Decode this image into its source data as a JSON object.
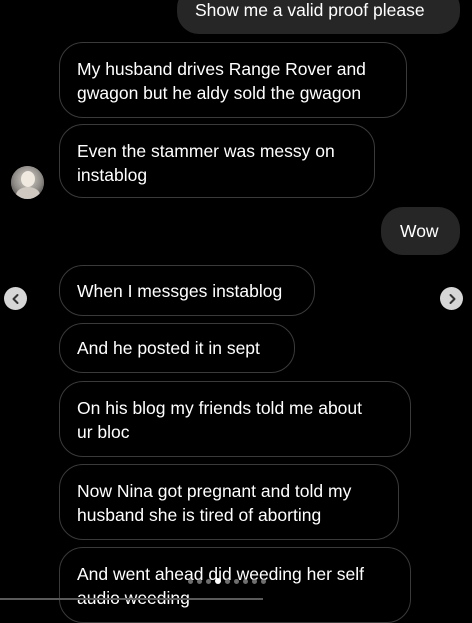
{
  "messages": [
    {
      "dir": "out",
      "lines": [
        "Show me a valid proof please"
      ]
    },
    {
      "dir": "in",
      "lines": [
        "My husband drives Range Rover and",
        "gwagon but he aldy sold the gwagon"
      ]
    },
    {
      "dir": "in",
      "lines": [
        "Even the stammer was messy on",
        "instablog"
      ]
    },
    {
      "dir": "out",
      "lines": [
        "Wow"
      ]
    },
    {
      "dir": "in",
      "lines": [
        "When I messges instablog"
      ]
    },
    {
      "dir": "in",
      "lines": [
        "And he posted it in sept"
      ]
    },
    {
      "dir": "in",
      "lines": [
        "On his blog my friends told me about",
        "ur bloc"
      ]
    },
    {
      "dir": "in",
      "lines": [
        "Now Nina got pregnant and told my",
        "husband she is tired of aborting"
      ]
    },
    {
      "dir": "in",
      "lines": [
        "And went ahead did weeding her self",
        "audio weeding"
      ]
    }
  ],
  "avatar": {
    "icon": "profile-avatar-icon"
  },
  "navigation": {
    "prev_icon": "chevron-left-icon",
    "next_icon": "chevron-right-icon"
  },
  "carousel": {
    "total": 9,
    "current_index": 3
  },
  "colors": {
    "background": "#000000",
    "outgoing_bubble": "#262626",
    "incoming_border": "#3a3a3a",
    "text": "#ffffff",
    "nav_button": "#d6d6d6"
  }
}
